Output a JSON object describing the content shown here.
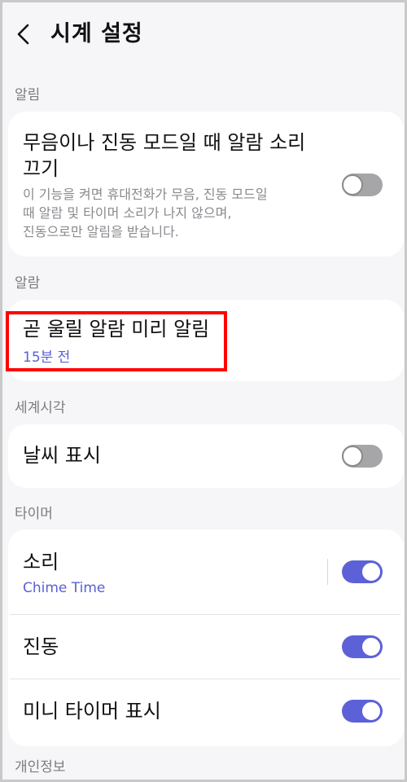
{
  "header": {
    "title": "시계 설정",
    "back_icon": "chevron-left-icon"
  },
  "sections": {
    "notifications": {
      "label": "알림",
      "mute_alarm": {
        "title_line1": "무음이나 진동 모드일 때 알람 소리",
        "title_line2": "끄기",
        "description_line1": "이 기능을 켜면 휴대전화가 무음, 진동 모드일",
        "description_line2": "때 알람 및 타이머 소리가 나지 않으며,",
        "description_line3": "진동으로만 알림을 받습니다.",
        "enabled": false
      }
    },
    "alarm": {
      "label": "알람",
      "upcoming": {
        "title": "곧 울릴 알람 미리 알림",
        "value": "15분 전"
      }
    },
    "world_clock": {
      "label": "세계시각",
      "weather": {
        "title": "날씨 표시",
        "enabled": false
      }
    },
    "timer": {
      "label": "타이머",
      "sound": {
        "title": "소리",
        "value": "Chime Time",
        "enabled": true
      },
      "vibration": {
        "title": "진동",
        "enabled": true
      },
      "mini_timer": {
        "title": "미니 타이머 표시",
        "enabled": true
      }
    },
    "privacy": {
      "label": "개인정보"
    }
  },
  "colors": {
    "accent": "#5d61d8",
    "toggle_off": "#a6a6a8",
    "highlight": "#ff0000",
    "background": "#f6f6f8"
  }
}
